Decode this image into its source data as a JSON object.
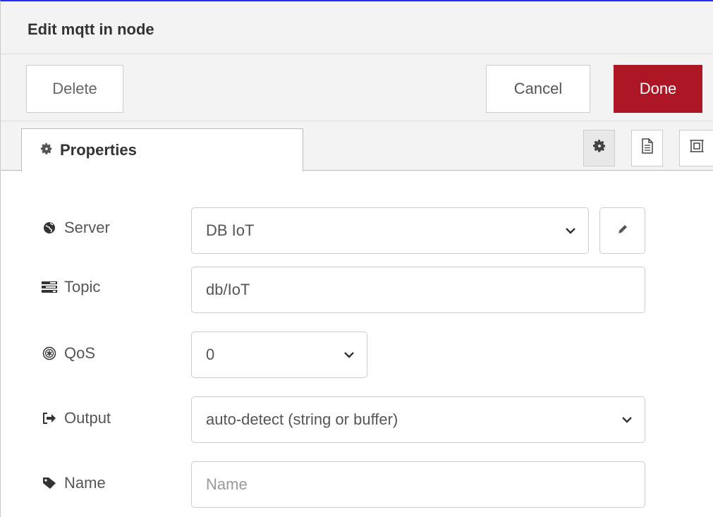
{
  "tray": {
    "title": "Edit mqtt in node"
  },
  "toolbar": {
    "delete_label": "Delete",
    "cancel_label": "Cancel",
    "done_label": "Done"
  },
  "tabs": {
    "active_label": "Properties",
    "icon_buttons": [
      "gear-icon",
      "document-icon",
      "frame-icon"
    ]
  },
  "form": {
    "server": {
      "label": "Server",
      "value": "DB IoT",
      "icon": "globe-icon"
    },
    "topic": {
      "label": "Topic",
      "value": "db/IoT",
      "icon": "tasks-icon"
    },
    "qos": {
      "label": "QoS",
      "value": "0",
      "icon": "qos-icon"
    },
    "output": {
      "label": "Output",
      "value": "auto-detect (string or buffer)",
      "icon": "sign-out-icon"
    },
    "name": {
      "label": "Name",
      "placeholder": "Name",
      "value": "",
      "icon": "tag-icon"
    }
  },
  "colors": {
    "done_bg": "#ad1625",
    "header_bg": "#f3f3f3",
    "border": "#cccccc"
  }
}
